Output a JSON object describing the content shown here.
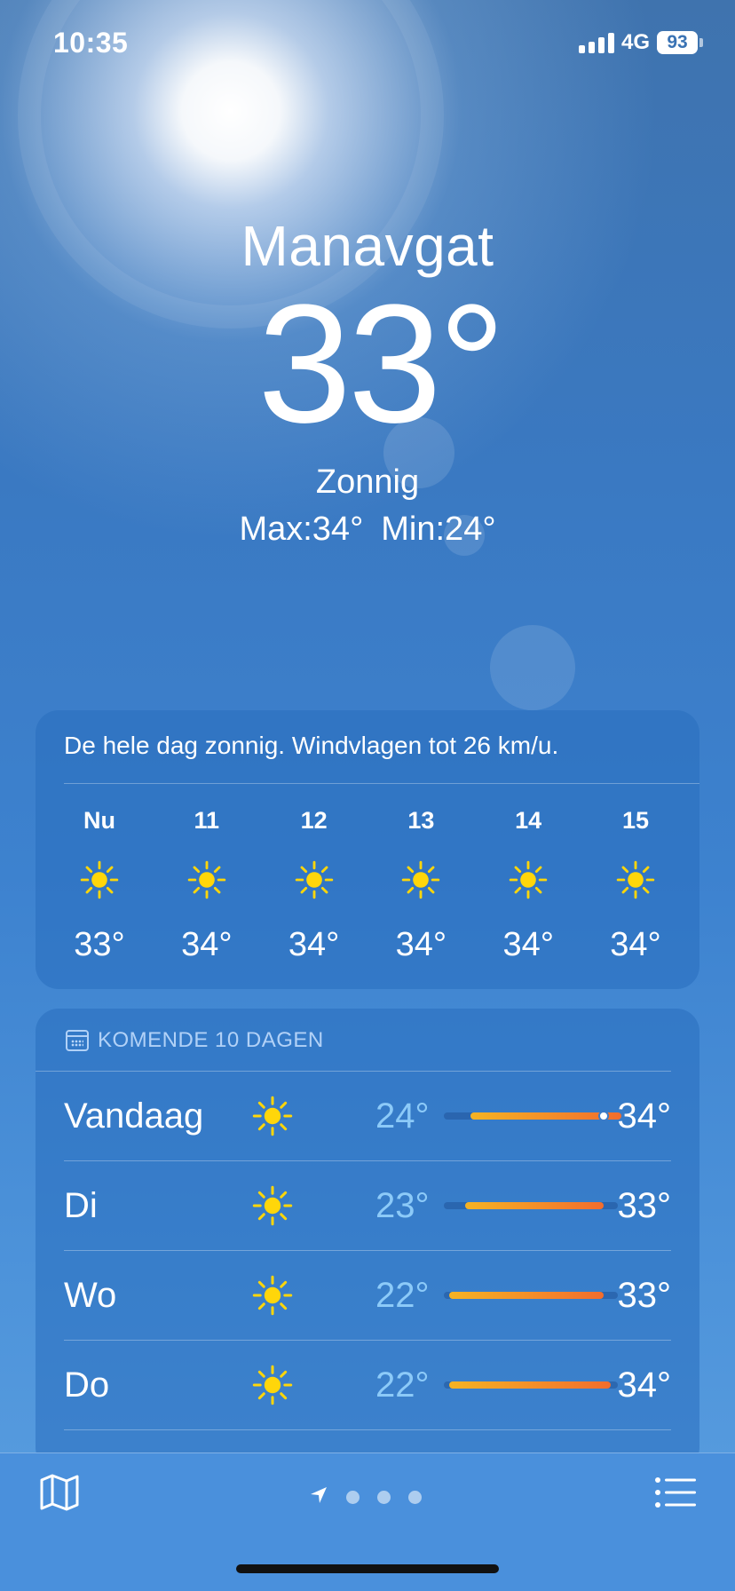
{
  "status_bar": {
    "time": "10:35",
    "network": "4G",
    "battery": "93"
  },
  "current": {
    "city": "Manavgat",
    "temperature": "33°",
    "condition": "Zonnig",
    "max": "Max:34°",
    "min": "Min:24°"
  },
  "hourly": {
    "summary": "De hele dag zonnig. Windvlagen tot 26 km/u.",
    "hours": [
      {
        "label": "Nu",
        "icon": "sun-icon",
        "temp": "33°"
      },
      {
        "label": "11",
        "icon": "sun-icon",
        "temp": "34°"
      },
      {
        "label": "12",
        "icon": "sun-icon",
        "temp": "34°"
      },
      {
        "label": "13",
        "icon": "sun-icon",
        "temp": "34°"
      },
      {
        "label": "14",
        "icon": "sun-icon",
        "temp": "34°"
      },
      {
        "label": "15",
        "icon": "sun-icon",
        "temp": "34°"
      }
    ]
  },
  "daily": {
    "header": "KOMENDE 10 DAGEN",
    "days": [
      {
        "name": "Vandaag",
        "icon": "sun-icon",
        "min": "24°",
        "max": "34°",
        "range_start": 0.15,
        "range_end": 1.0,
        "current": 0.9
      },
      {
        "name": "Di",
        "icon": "sun-icon",
        "min": "23°",
        "max": "33°",
        "range_start": 0.12,
        "range_end": 0.9
      },
      {
        "name": "Wo",
        "icon": "sun-icon",
        "min": "22°",
        "max": "33°",
        "range_start": 0.03,
        "range_end": 0.9
      },
      {
        "name": "Do",
        "icon": "sun-icon",
        "min": "22°",
        "max": "34°",
        "range_start": 0.03,
        "range_end": 0.94
      }
    ]
  },
  "bottom_bar": {
    "map_icon": "map-icon",
    "location_icon": "location-arrow-icon",
    "page_count": 3,
    "list_icon": "list-icon"
  },
  "colors": {
    "sun": "#ffd60a",
    "min_temp": "#8ccaf8",
    "bar_start": "#f5b324",
    "bar_end": "#f26d2d"
  }
}
